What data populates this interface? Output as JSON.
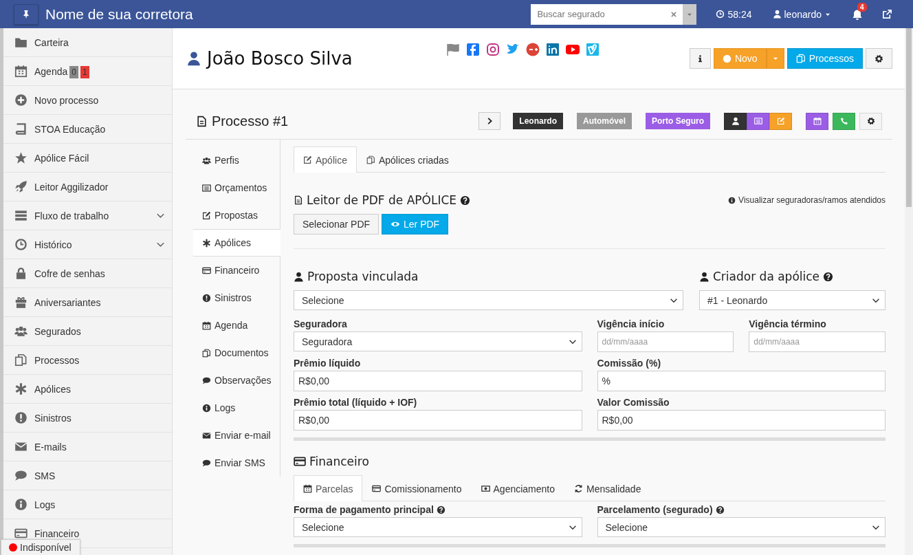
{
  "topbar": {
    "title": "Nome de sua corretora",
    "search": {
      "placeholder": "Buscar segurado"
    },
    "timer": "58:24",
    "user": "leonardo",
    "notifications": "4"
  },
  "sidebar": {
    "items": [
      {
        "label": "Carteira",
        "has_submenu": false
      },
      {
        "label": "Agenda",
        "has_submenu": false,
        "badges": [
          {
            "text": "0",
            "color": "#888888"
          },
          {
            "text": "1",
            "color": "#e53935"
          }
        ]
      },
      {
        "label": "Novo processo",
        "has_submenu": false
      },
      {
        "label": "STOA Educação",
        "has_submenu": false
      },
      {
        "label": "Apólice Fácil",
        "has_submenu": false
      },
      {
        "label": "Leitor Aggilizador",
        "has_submenu": false
      },
      {
        "label": "Fluxo de trabalho",
        "has_submenu": true
      },
      {
        "label": "Histórico",
        "has_submenu": true
      },
      {
        "label": "Cofre de senhas",
        "has_submenu": false
      },
      {
        "label": "Aniversariantes",
        "has_submenu": false
      },
      {
        "label": "Segurados",
        "has_submenu": false
      },
      {
        "label": "Processos",
        "has_submenu": false
      },
      {
        "label": "Apólices",
        "has_submenu": false
      },
      {
        "label": "Sinistros",
        "has_submenu": false
      },
      {
        "label": "E-mails",
        "has_submenu": false
      },
      {
        "label": "SMS",
        "has_submenu": false
      },
      {
        "label": "Logs",
        "has_submenu": false
      },
      {
        "label": "Financeiro",
        "has_submenu": false
      }
    ]
  },
  "status": {
    "label": "Indisponível",
    "color": "#ff0000"
  },
  "client": {
    "name": "João Bosco Silva",
    "buttons": {
      "new": "Novo",
      "processes": "Processos"
    }
  },
  "process": {
    "title": "Processo #1",
    "tags": [
      {
        "text": "Leonardo",
        "color": "#333333"
      },
      {
        "text": "Automóvel",
        "color": "#999999"
      },
      {
        "text": "Porto Seguro",
        "color": "#9b5de5"
      }
    ],
    "action_groups": [
      [
        {
          "color": "#333333"
        },
        {
          "color": "#9b5de5"
        },
        {
          "color": "#f6a128"
        }
      ],
      [
        {
          "color": "#9b5de5"
        },
        {
          "color": "#3cb85c"
        },
        {
          "color": "#f4f4f4"
        }
      ]
    ],
    "nav": [
      {
        "label": "Perfis",
        "selected": false
      },
      {
        "label": "Orçamentos",
        "selected": false
      },
      {
        "label": "Propostas",
        "selected": false
      },
      {
        "label": "Apólices",
        "selected": true
      },
      {
        "label": "Financeiro",
        "selected": false
      },
      {
        "label": "Sinistros",
        "selected": false
      },
      {
        "label": "Agenda",
        "selected": false
      },
      {
        "label": "Documentos",
        "selected": false
      },
      {
        "label": "Observações",
        "selected": false
      },
      {
        "label": "Logs",
        "selected": false
      },
      {
        "label": "Enviar e-mail",
        "selected": false
      },
      {
        "label": "Enviar SMS",
        "selected": false
      }
    ],
    "tabs": [
      {
        "label": "Apólice",
        "selected": true
      },
      {
        "label": "Apólices criadas",
        "selected": false
      }
    ],
    "pdf_reader": {
      "title": "Leitor de PDF de APÓLICE",
      "link": "Visualizar seguradoras/ramos atendidos",
      "select_button": "Selecionar PDF",
      "read_button": "Ler PDF"
    },
    "linked": [
      {
        "heading": "Proposta vinculada",
        "value": "Selecione"
      },
      {
        "heading": "Criador da apólice",
        "value": "#1 - Leonardo",
        "help": true
      }
    ],
    "fields": [
      {
        "label": "Seguradora",
        "kind": "select",
        "value": "Seguradora"
      },
      {
        "label": "Vigência início",
        "kind": "date",
        "placeholder": "dd/mm/aaaa"
      },
      {
        "label": "Vigência término",
        "kind": "date",
        "placeholder": "dd/mm/aaaa"
      },
      {
        "label": "Prêmio líquido",
        "kind": "text",
        "value": "R$0,00"
      },
      {
        "label": "Comissão (%)",
        "kind": "text",
        "value": "%"
      },
      {
        "label": "Prêmio total (líquido + IOF)",
        "kind": "text",
        "value": "R$0,00"
      },
      {
        "label": "Valor Comissão",
        "kind": "text",
        "value": "R$0,00"
      }
    ],
    "finance": {
      "heading": "Financeiro",
      "tabs": [
        {
          "label": "Parcelas",
          "selected": true
        },
        {
          "label": "Comissionamento",
          "selected": false
        },
        {
          "label": "Agenciamento",
          "selected": false
        },
        {
          "label": "Mensalidade",
          "selected": false
        }
      ],
      "fields": [
        {
          "label": "Forma de pagamento principal",
          "kind": "select",
          "value": "Selecione",
          "help": true
        },
        {
          "label": "Parcelamento (segurado)",
          "kind": "select",
          "value": "Selecione",
          "help": true
        }
      ]
    }
  }
}
